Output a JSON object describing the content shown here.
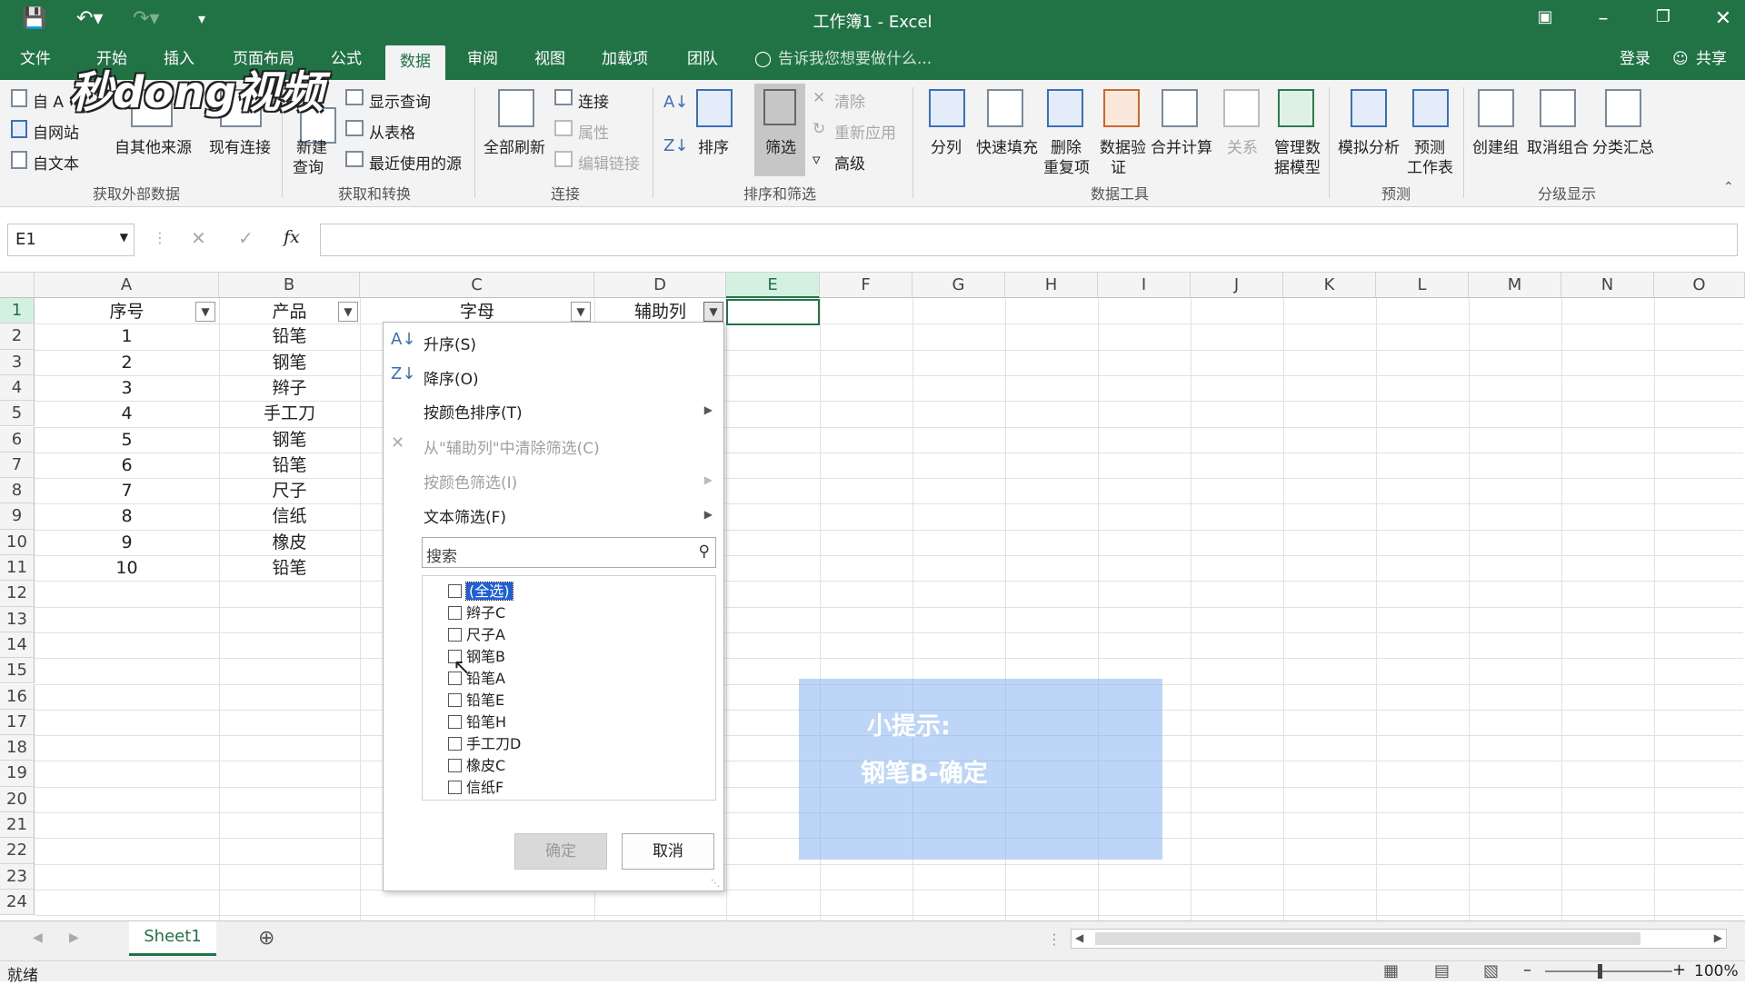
{
  "window": {
    "title": "工作簿1 - Excel"
  },
  "tabs": [
    "文件",
    "开始",
    "插入",
    "页面布局",
    "公式",
    "数据",
    "审阅",
    "视图",
    "加载项",
    "团队"
  ],
  "active_tab": "数据",
  "tell_me": "告诉我您想要做什么...",
  "account": {
    "login": "登录",
    "share": "共享"
  },
  "ribbon": {
    "get_external": {
      "access": "自 A",
      "web": "自网站",
      "text": "自文本",
      "other": "自其他来源",
      "existing": "现有连接",
      "group": "获取外部数据"
    },
    "get_transform": {
      "new_query": "新建",
      "new_query2": "查询",
      "show_query": "显示查询",
      "from_table": "从表格",
      "recent": "最近使用的源",
      "group": "获取和转换"
    },
    "connections": {
      "refresh_all": "全部刷新",
      "connections": "连接",
      "properties": "属性",
      "edit_links": "编辑链接",
      "group": "连接"
    },
    "sort_filter": {
      "sort": "排序",
      "filter": "筛选",
      "clear": "清除",
      "reapply": "重新应用",
      "advanced": "高级",
      "group": "排序和筛选"
    },
    "data_tools": {
      "text_to_columns": "分列",
      "flash_fill": "快速填充",
      "remove_dup": "删除",
      "remove_dup2": "重复项",
      "validation": "数据验",
      "validation2": "证",
      "consolidate": "合并计算",
      "relations": "关系",
      "model": "管理数",
      "model2": "据模型",
      "group": "数据工具"
    },
    "forecast": {
      "what_if": "模拟分析",
      "sheet": "预测",
      "sheet2": "工作表",
      "group": "预测"
    },
    "outline": {
      "group_btn": "创建组",
      "ungroup": "取消组合",
      "subtotal": "分类汇总",
      "group": "分级显示"
    }
  },
  "formula_bar": {
    "name_box": "E1",
    "fx": "fx",
    "value": ""
  },
  "columns": [
    "A",
    "B",
    "C",
    "D",
    "E",
    "F",
    "G",
    "H",
    "I",
    "J",
    "K",
    "L",
    "M",
    "N",
    "O"
  ],
  "row_numbers": [
    "1",
    "2",
    "3",
    "4",
    "5",
    "6",
    "7",
    "8",
    "9",
    "10",
    "11",
    "12",
    "13",
    "14",
    "15",
    "16",
    "17",
    "18",
    "19",
    "20",
    "21",
    "22",
    "23",
    "24"
  ],
  "headers": {
    "a": "序号",
    "b": "产品",
    "c": "字母",
    "d": "辅助列"
  },
  "rows": [
    {
      "a": "1",
      "b": "铅笔"
    },
    {
      "a": "2",
      "b": "钢笔"
    },
    {
      "a": "3",
      "b": "辫子"
    },
    {
      "a": "4",
      "b": "手工刀"
    },
    {
      "a": "5",
      "b": "钢笔"
    },
    {
      "a": "6",
      "b": "铅笔"
    },
    {
      "a": "7",
      "b": "尺子"
    },
    {
      "a": "8",
      "b": "信纸"
    },
    {
      "a": "9",
      "b": "橡皮"
    },
    {
      "a": "10",
      "b": "铅笔"
    }
  ],
  "filter_menu": {
    "sort_asc": "升序(S)",
    "sort_desc": "降序(O)",
    "sort_color": "按颜色排序(T)",
    "clear_filter": "从\"辅助列\"中清除筛选(C)",
    "filter_color": "按颜色筛选(I)",
    "text_filter": "文本筛选(F)",
    "search_placeholder": "搜索",
    "items": [
      "(全选)",
      "辫子C",
      "尺子A",
      "钢笔B",
      "铅笔A",
      "铅笔E",
      "铅笔H",
      "手工刀D",
      "橡皮C",
      "信纸F"
    ],
    "ok": "确定",
    "cancel": "取消"
  },
  "hint": {
    "line1": "小提示:",
    "line2": "钢笔B-确定"
  },
  "watermark": "秒dong视频",
  "sheet_tab": "Sheet1",
  "status": {
    "ready": "就绪",
    "zoom": "100%"
  },
  "colors": {
    "accent": "#217346",
    "hint_bg": "#87b2f0",
    "selection": "#1e5fd8"
  }
}
